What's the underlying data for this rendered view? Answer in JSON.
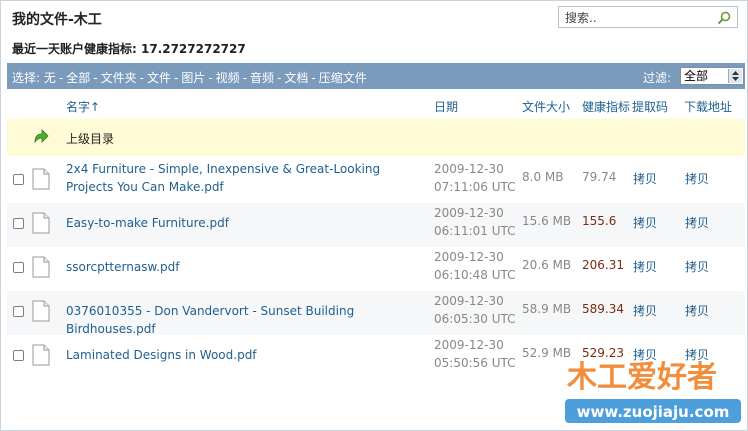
{
  "page": {
    "title": "我的文件-木工",
    "health_line": "最近一天账户健康指标: 17.2727272727"
  },
  "search": {
    "placeholder": "搜索.."
  },
  "toolbar": {
    "select_label": "选择:",
    "options": [
      "无",
      "全部",
      "文件夹",
      "文件",
      "图片",
      "视频",
      "音频",
      "文档",
      "压缩文件"
    ],
    "filter_label": "过滤:",
    "filter_value": "全部"
  },
  "columns": {
    "name": "名字↑",
    "date": "日期",
    "size": "文件大小",
    "health": "健康指标",
    "code": "提取码",
    "download": "下载地址"
  },
  "parent_dir": {
    "label": "上级目录"
  },
  "files": [
    {
      "name": "2x4 Furniture - Simple, Inexpensive & Great-Looking Projects You Can Make.pdf",
      "date": "2009-12-30",
      "time": "07:11:06 UTC",
      "size": "8.0 MB",
      "health": "79.74",
      "code": "拷贝",
      "download": "拷贝"
    },
    {
      "name": "Easy-to-make Furniture.pdf",
      "date": "2009-12-30",
      "time": "06:11:01 UTC",
      "size": "15.6 MB",
      "health": "155.6",
      "code": "拷贝",
      "download": "拷贝"
    },
    {
      "name": "ssorcptternasw.pdf",
      "date": "2009-12-30",
      "time": "06:10:48 UTC",
      "size": "20.6 MB",
      "health": "206.31",
      "code": "拷贝",
      "download": "拷贝"
    },
    {
      "name": "0376010355 - Don Vandervort - Sunset Building Birdhouses.pdf",
      "date": "2009-12-30",
      "time": "06:05:30 UTC",
      "size": "58.9 MB",
      "health": "589.34",
      "code": "拷贝",
      "download": "拷贝"
    },
    {
      "name": "Laminated Designs in Wood.pdf",
      "date": "2009-12-30",
      "time": "05:50:56 UTC",
      "size": "52.9 MB",
      "health": "529.23",
      "code": "拷贝",
      "download": "拷贝"
    }
  ],
  "watermark": {
    "text_cn": "木工爱好者",
    "url": "www.zuojiaju.com"
  },
  "colors": {
    "toolbar_bg": "#7b9bbd",
    "link": "#1f5f8f",
    "parent_row_bg": "#fffbd6",
    "health_value": "#7a2a14"
  },
  "icons": [
    "search-icon",
    "up-arrow-icon",
    "file-icon",
    "chevron-updown-icon"
  ]
}
